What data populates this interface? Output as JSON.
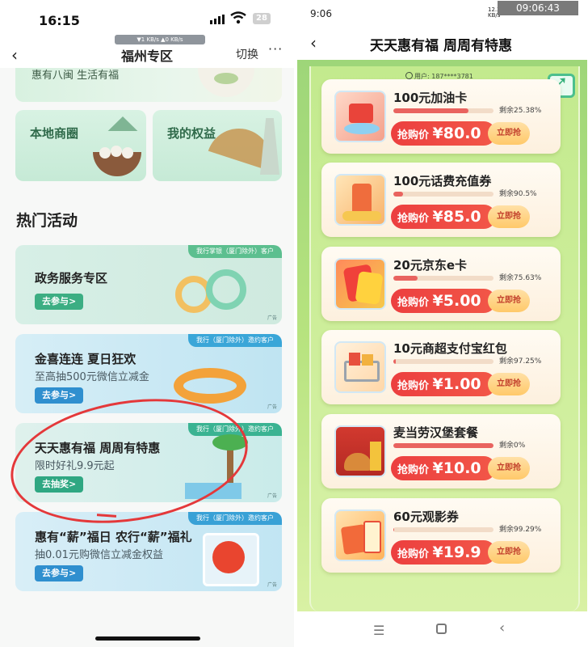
{
  "left": {
    "status": {
      "time": "16:15",
      "battery": "28"
    },
    "nav": {
      "speed": "▼1 KB/s ▲0 KB/s",
      "back": "‹",
      "title": "福州专区",
      "switch": "切换",
      "more": "···"
    },
    "banner_text": "惠有八闽 生活有福",
    "cards": [
      {
        "title": "本地商圈"
      },
      {
        "title": "我的权益"
      }
    ],
    "section_title": "热门活动",
    "activities": [
      {
        "tag": "我行掌银（厦门除外）客户",
        "title": "政务服务专区",
        "subtitle": "",
        "button": "去参与>",
        "ad": "广告"
      },
      {
        "tag": "我行（厦门除外）邀约客户",
        "title": "金喜连连 夏日狂欢",
        "subtitle": "至高抽500元微信立减金",
        "button": "去参与>",
        "ad": "广告"
      },
      {
        "tag": "我行（厦门除外）邀约客户",
        "title": "天天惠有福 周周有特惠",
        "subtitle": "限时好礼9.9元起",
        "button": "去抽奖>",
        "ad": "广告"
      },
      {
        "tag": "我行（厦门除外）邀约客户",
        "title": "惠有“薪”福日 农行“薪”福礼",
        "subtitle": "抽0.01元购微信立减金权益",
        "button": "去参与>",
        "ad": "广告"
      }
    ]
  },
  "right": {
    "status": {
      "time": "9:06",
      "watermark": "09:06:43",
      "net_top": "12.2",
      "net_bottom": "KB/s"
    },
    "header": {
      "back": "‹",
      "title": "天天惠有福 周周有特惠"
    },
    "user": "用户: 187****3781",
    "items": [
      {
        "title": "100元加油卡",
        "remain": "剩余25.38%",
        "remain_pct": 74.62,
        "price_label": "抢购价",
        "price": "¥80.0",
        "buy": "立即抢"
      },
      {
        "title": "100元话费充值券",
        "remain": "剩余90.5%",
        "remain_pct": 9.5,
        "price_label": "抢购价",
        "price": "¥85.0",
        "buy": "立即抢"
      },
      {
        "title": "20元京东e卡",
        "remain": "剩余75.63%",
        "remain_pct": 24.37,
        "price_label": "抢购价",
        "price": "¥5.00",
        "buy": "立即抢"
      },
      {
        "title": "10元商超支付宝红包",
        "remain": "剩余97.25%",
        "remain_pct": 2.75,
        "price_label": "抢购价",
        "price": "¥1.00",
        "buy": "立即抢"
      },
      {
        "title": "麦当劳汉堡套餐",
        "remain": "剩余0%",
        "remain_pct": 100,
        "price_label": "抢购价",
        "price": "¥10.0",
        "buy": "立即抢"
      },
      {
        "title": "60元观影券",
        "remain": "剩余99.29%",
        "remain_pct": 0.71,
        "price_label": "抢购价",
        "price": "¥19.9",
        "buy": "立即抢"
      }
    ],
    "nav": {
      "menu": "☰",
      "back": "‹"
    }
  },
  "icons": {
    "left_back": "chevron-left-icon",
    "wifi": "wifi-icon",
    "signal": "signal-icon",
    "battery": "battery-icon",
    "share": "share-icon",
    "user": "user-icon"
  }
}
